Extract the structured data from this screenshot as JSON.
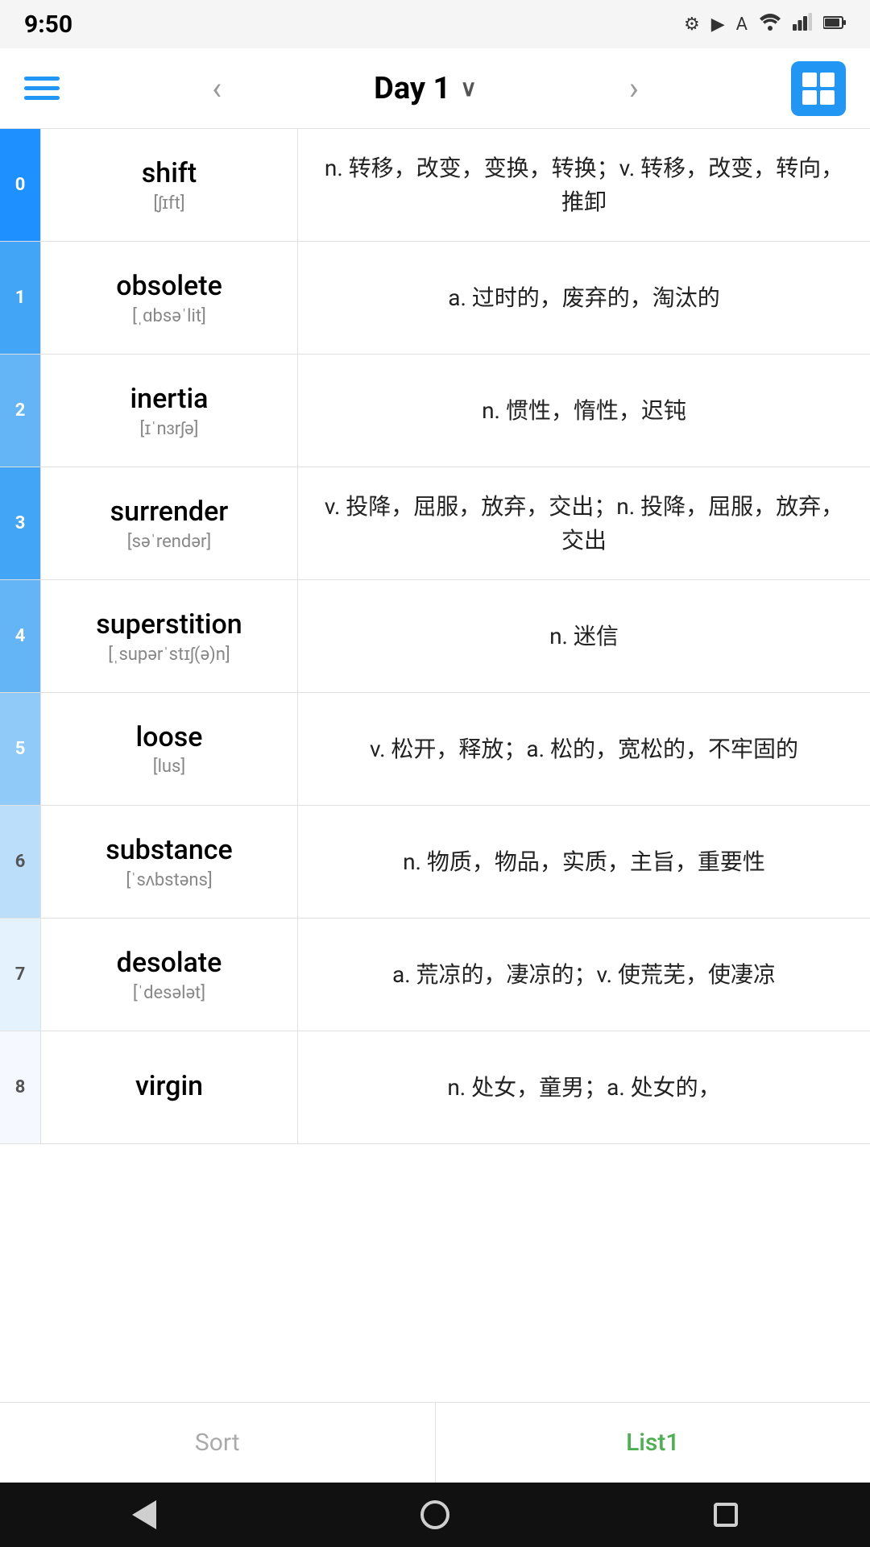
{
  "statusBar": {
    "time": "9:50",
    "icons": [
      "⚙",
      "▶",
      "A",
      "?",
      "•"
    ]
  },
  "navBar": {
    "title": "Day 1",
    "prevLabel": "‹",
    "nextLabel": "›"
  },
  "words": [
    {
      "index": "0",
      "english": "shift",
      "phonetic": "[ʃɪft]",
      "definition": "n. 转移，改变，变换，转换；v. 转移，改变，转向，推卸"
    },
    {
      "index": "1",
      "english": "obsolete",
      "phonetic": "[ˌɑbsəˈlit]",
      "definition": "a. 过时的，废弃的，淘汰的"
    },
    {
      "index": "2",
      "english": "inertia",
      "phonetic": "[ɪˈnɜrʃə]",
      "definition": "n. 惯性，惰性，迟钝"
    },
    {
      "index": "3",
      "english": "surrender",
      "phonetic": "[səˈrendər]",
      "definition": "v. 投降，屈服，放弃，交出；n. 投降，屈服，放弃，交出"
    },
    {
      "index": "4",
      "english": "superstition",
      "phonetic": "[ˌsupərˈstɪʃ(ə)n]",
      "definition": "n. 迷信"
    },
    {
      "index": "5",
      "english": "loose",
      "phonetic": "[lus]",
      "definition": "v. 松开，释放；a. 松的，宽松的，不牢固的"
    },
    {
      "index": "6",
      "english": "substance",
      "phonetic": "[ˈsʌbstəns]",
      "definition": "n. 物质，物品，实质，主旨，重要性"
    },
    {
      "index": "7",
      "english": "desolate",
      "phonetic": "[ˈdesələt]",
      "definition": "a. 荒凉的，凄凉的；v. 使荒芜，使凄凉"
    },
    {
      "index": "8",
      "english": "virgin",
      "phonetic": "",
      "definition": "n. 处女，童男；a. 处女的，"
    }
  ],
  "bottomTabs": {
    "sort": "Sort",
    "list1": "List1"
  },
  "androidNav": {
    "back": "back",
    "home": "home",
    "recent": "recent"
  }
}
